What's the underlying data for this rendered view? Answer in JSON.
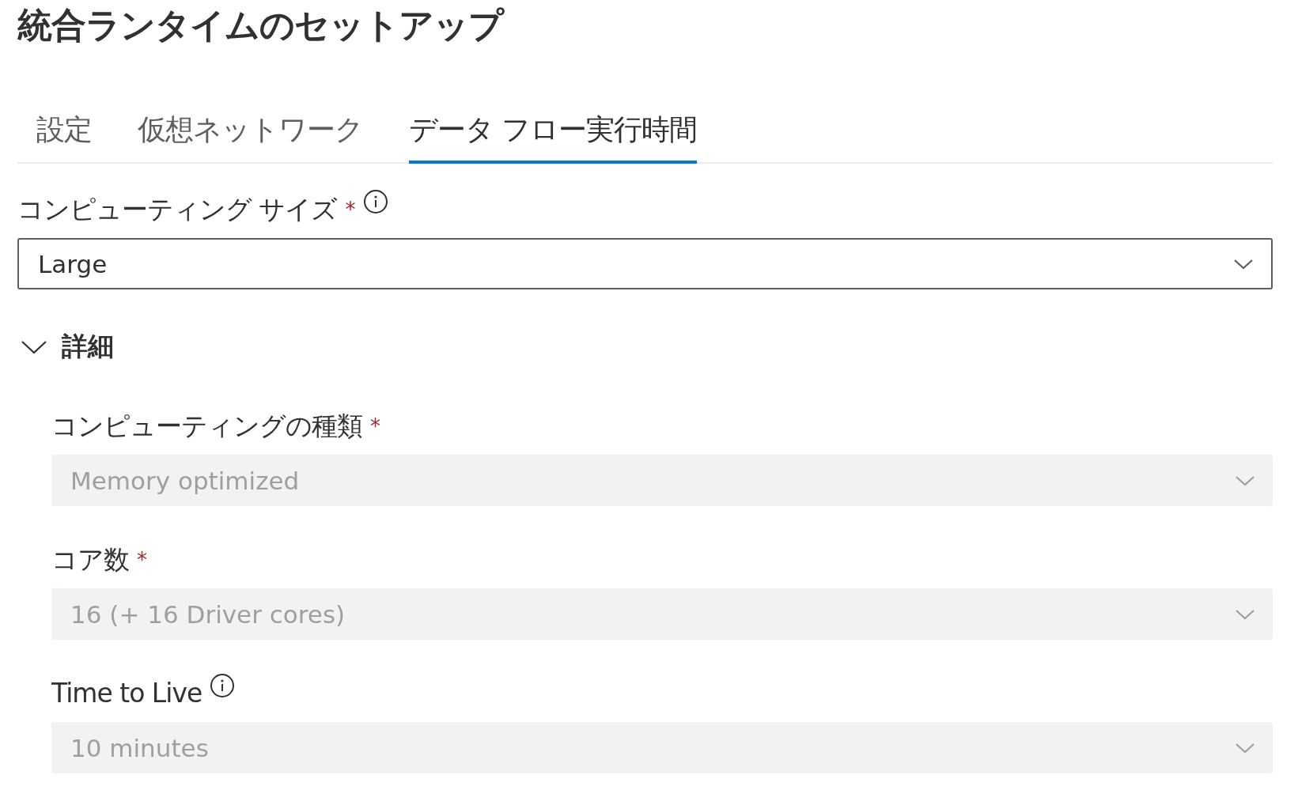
{
  "title": "統合ランタイムのセットアップ",
  "tabs": [
    {
      "label": "設定",
      "selected": false
    },
    {
      "label": "仮想ネットワーク",
      "selected": false
    },
    {
      "label": "データ フロー実行時間",
      "selected": true
    }
  ],
  "compute_size": {
    "label": "コンピューティング サイズ",
    "required_mark": "*",
    "info": true,
    "value": "Large",
    "disabled": false
  },
  "details": {
    "label": "詳細",
    "expanded": true,
    "fields": [
      {
        "label": "コンピューティングの種類",
        "required_mark": "*",
        "value": "Memory optimized",
        "disabled": true
      },
      {
        "label": "コア数",
        "required_mark": "*",
        "value": "16 (+ 16 Driver cores)",
        "disabled": true
      },
      {
        "label": "Time to Live",
        "info": true,
        "value": "10 minutes",
        "disabled": true
      }
    ]
  }
}
